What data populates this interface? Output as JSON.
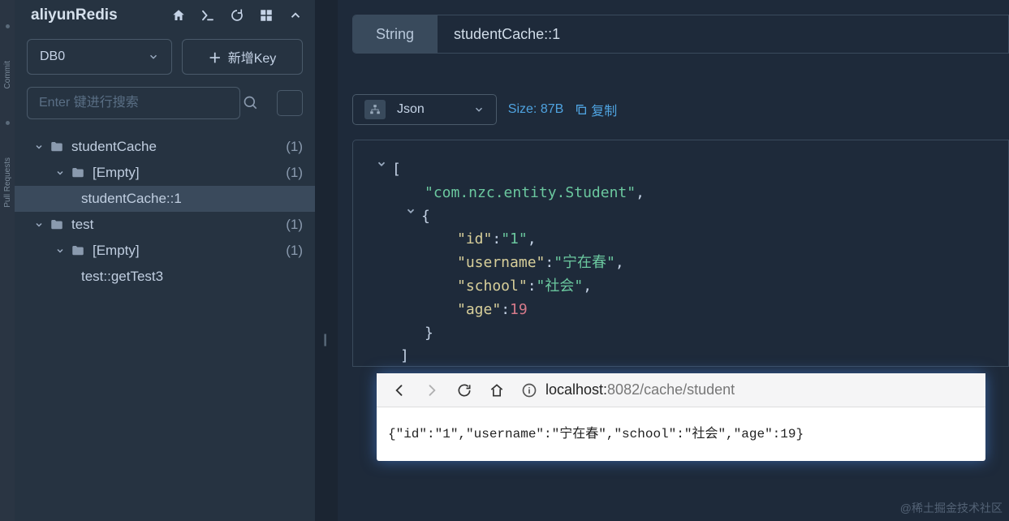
{
  "sidebar": {
    "title": "aliyunRedis",
    "db_selector": "DB0",
    "new_key_btn": "新增Key",
    "search_placeholder": "Enter 键进行搜索",
    "tree": [
      {
        "label": "studentCache",
        "count": "(1)",
        "type": "folder",
        "level": 1
      },
      {
        "label": "[Empty]",
        "count": "(1)",
        "type": "folder",
        "level": 2
      },
      {
        "label": "studentCache::1",
        "count": "",
        "type": "key",
        "level": 3,
        "selected": true
      },
      {
        "label": "test",
        "count": "(1)",
        "type": "folder",
        "level": 1
      },
      {
        "label": "[Empty]",
        "count": "(1)",
        "type": "folder",
        "level": 2
      },
      {
        "label": "test::getTest3",
        "count": "",
        "type": "key",
        "level": 3
      }
    ]
  },
  "main": {
    "type_badge": "String",
    "key_name": "studentCache::1",
    "format_selector": "Json",
    "size_text": "Size: 87B",
    "copy_text": "复制",
    "json_view": {
      "class_name": "\"com.nzc.entity.Student\"",
      "fields": [
        {
          "key": "\"id\"",
          "value": "\"1\"",
          "kind": "str"
        },
        {
          "key": "\"username\"",
          "value": "\"宁在春\"",
          "kind": "str"
        },
        {
          "key": "\"school\"",
          "value": "\"社会\"",
          "kind": "str"
        },
        {
          "key": "\"age\"",
          "value": "19",
          "kind": "num"
        }
      ]
    }
  },
  "browser": {
    "url_host": "localhost:",
    "url_path": "8082/cache/student",
    "body": "{\"id\":\"1\",\"username\":\"宁在春\",\"school\":\"社会\",\"age\":19}"
  },
  "watermark": "@稀土掘金技术社区",
  "gutter": {
    "t1": "Commit",
    "t2": "Pull Requests"
  }
}
